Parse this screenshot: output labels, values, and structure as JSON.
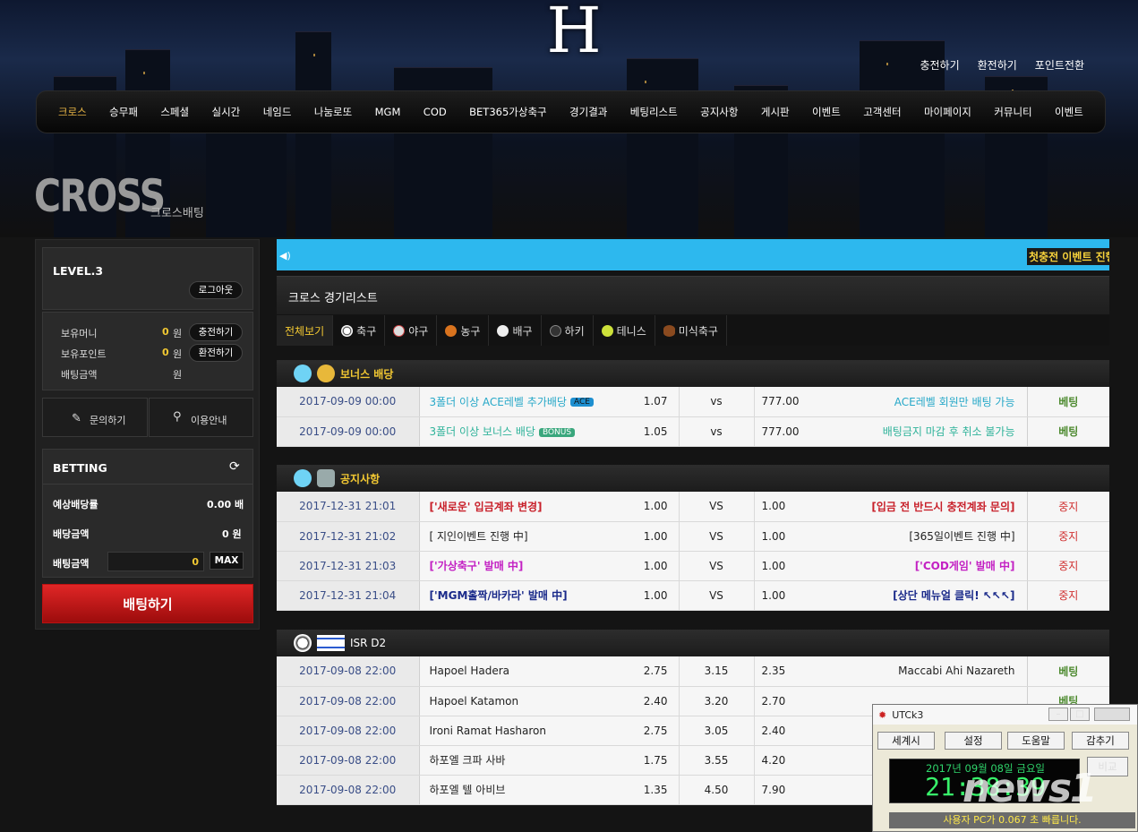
{
  "logo": "H",
  "top_links": [
    "충전하기",
    "환전하기",
    "포인트전환"
  ],
  "nav": [
    "크로스",
    "승무패",
    "스페셜",
    "실시간",
    "네임드",
    "나눔로또",
    "MGM",
    "COD",
    "BET365가상축구",
    "경기결과",
    "베팅리스트",
    "공지사항",
    "게시판",
    "이벤트",
    "고객센터",
    "마이페이지",
    "커뮤니티",
    "이벤트"
  ],
  "page": {
    "title": "CROSS",
    "subtitle": "크로스배팅"
  },
  "account": {
    "level": "LEVEL.3",
    "logout": "로그아웃",
    "money_label": "보유머니",
    "money_value": "0",
    "money_unit": "원",
    "charge": "충전하기",
    "point_label": "보유포인트",
    "point_value": "0",
    "point_unit": "원",
    "exchange": "환전하기",
    "betamount_label": "배팅금액",
    "betamount_unit": "원"
  },
  "help": {
    "inquiry": "문의하기",
    "guide": "이용안내"
  },
  "betting": {
    "title": "BETTING",
    "expected_label": "예상배당률",
    "expected_value": "0.00 배",
    "payout_label": "배당금액",
    "payout_value": "0 원",
    "amount_label": "배팅금액",
    "amount_value": "0",
    "max": "MAX",
    "submit": "배팅하기"
  },
  "ticker": "첫충전 이벤트 진행",
  "list_title": "크로스 경기리스트",
  "tabs": [
    "전체보기",
    "축구",
    "야구",
    "농구",
    "배구",
    "하키",
    "테니스",
    "미식축구"
  ],
  "sections": [
    {
      "title": "보너스 배당",
      "rows": [
        {
          "date": "2017-09-09 00:00",
          "home": "3폴더 이상 ACE레벨 추가배당",
          "badge": "ACE",
          "o1": "1.07",
          "vs": "vs",
          "o2": "777.00",
          "away": "ACE레벨 회원만 배팅 가능",
          "act": "베팅"
        },
        {
          "date": "2017-09-09 00:00",
          "home": "3폴더 이상 보너스 배당",
          "badge": "BONUS",
          "o1": "1.05",
          "vs": "vs",
          "o2": "777.00",
          "away": "배팅금지 마감 후 취소 불가능",
          "act": "베팅"
        }
      ]
    },
    {
      "title": "공지사항",
      "rows": [
        {
          "date": "2017-12-31 21:01",
          "home": "['새로운' 입금계좌 변경]",
          "o1": "1.00",
          "vs": "VS",
          "o2": "1.00",
          "away": "[입금 전 반드시 충전계좌 문의]",
          "act": "중지"
        },
        {
          "date": "2017-12-31 21:02",
          "home": "[ 지인이벤트 진행 中]",
          "o1": "1.00",
          "vs": "VS",
          "o2": "1.00",
          "away": "[365일이벤트 진행 中]",
          "act": "중지"
        },
        {
          "date": "2017-12-31 21:03",
          "home": "['가상축구' 발매 中]",
          "o1": "1.00",
          "vs": "VS",
          "o2": "1.00",
          "away": "['COD게임' 발매 中]",
          "act": "중지"
        },
        {
          "date": "2017-12-31 21:04",
          "home": "['MGM홀짝/바카라' 발매 中]",
          "o1": "1.00",
          "vs": "VS",
          "o2": "1.00",
          "away": "[상단 메뉴얼 클릭! ↖↖↖]",
          "act": "중지"
        }
      ]
    },
    {
      "title": "ISR D2",
      "rows": [
        {
          "date": "2017-09-08 22:00",
          "home": "Hapoel Hadera",
          "o1": "2.75",
          "vs": "3.15",
          "o2": "2.35",
          "away": "Maccabi Ahi Nazareth",
          "act": "베팅"
        },
        {
          "date": "2017-09-08 22:00",
          "home": "Hapoel Katamon",
          "o1": "2.40",
          "vs": "3.20",
          "o2": "2.70",
          "away": "",
          "act": "베팅"
        },
        {
          "date": "2017-09-08 22:00",
          "home": "Ironi Ramat Hasharon",
          "o1": "2.75",
          "vs": "3.05",
          "o2": "2.40",
          "away": "",
          "act": ""
        },
        {
          "date": "2017-09-08 22:00",
          "home": "하포엘 크파 사바",
          "o1": "1.75",
          "vs": "3.55",
          "o2": "4.20",
          "away": "",
          "act": ""
        },
        {
          "date": "2017-09-08 22:00",
          "home": "하포엘 텔 아비브",
          "o1": "1.35",
          "vs": "4.50",
          "o2": "7.90",
          "away": "",
          "act": ""
        }
      ]
    }
  ],
  "widget": {
    "title": "UTCk3",
    "menu": [
      "세계시",
      "설정",
      "도움말",
      "감추기"
    ],
    "date": "2017년 09월 08일 금요일",
    "time": "21:38:39",
    "compare": "비교",
    "message": "사용자 PC가 0.067 초 빠릅니다."
  },
  "watermark": "news1",
  "colors": {
    "accent": "#f2c832",
    "nav_active": "#e8b545",
    "ticker_bg": "#2db8ee",
    "bet_button": "#d01c1c",
    "row_date": "#3a4e87"
  }
}
